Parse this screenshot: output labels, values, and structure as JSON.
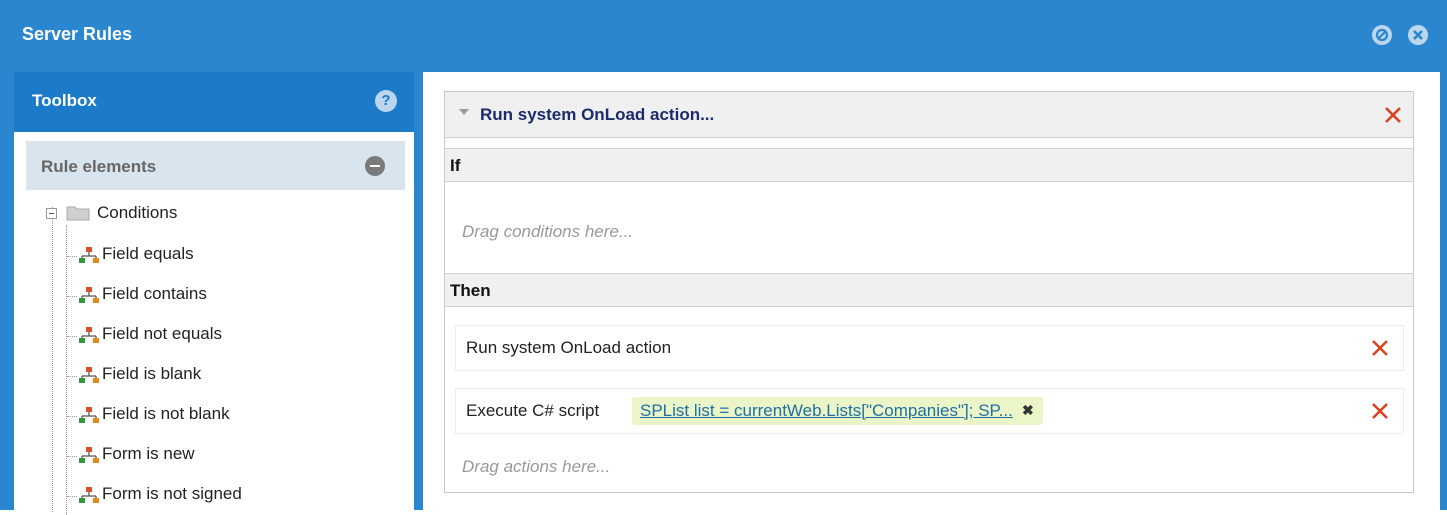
{
  "window": {
    "title": "Server Rules"
  },
  "titlebar_buttons": [
    {
      "icon": "pin-icon"
    },
    {
      "icon": "close-icon"
    }
  ],
  "toolbox": {
    "title": "Toolbox",
    "help_icon": "?",
    "section": {
      "title": "Rule elements"
    },
    "tree": {
      "folder": "Conditions",
      "items": [
        "Field equals",
        "Field contains",
        "Field not equals",
        "Field is blank",
        "Field is not blank",
        "Form is new",
        "Form is not signed"
      ]
    }
  },
  "rule": {
    "title": "Run system OnLoad action...",
    "if_label": "If",
    "conditions_placeholder": "Drag conditions here...",
    "then_label": "Then",
    "actions": [
      {
        "label": "Run system OnLoad action"
      },
      {
        "label": "Execute C# script",
        "script_preview": "SPList list = currentWeb.Lists[\"Companies\"]; SP...",
        "remove_glyph": "✖"
      }
    ],
    "actions_placeholder": "Drag actions here..."
  },
  "colors": {
    "titlebar": "#2a86cf",
    "toolbox_header": "#1b7bc8",
    "delete_x": "#d9431e",
    "script_tag": "#eaf6c7"
  }
}
